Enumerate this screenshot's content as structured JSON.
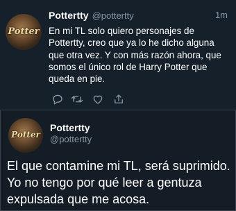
{
  "tweet": {
    "display_name": "Pottertty",
    "handle": "@pottertty",
    "time": "1m",
    "text": "En mi TL solo quiero personajes de Pottertty, creo que ya lo he dicho alguna que otra vez. Y con más razón ahora, que somos el único rol de Harry Potter que queda en pie.",
    "avatar_logo": "Potter",
    "actions": [
      "reply-icon",
      "retweet-icon",
      "like-icon",
      "share-icon"
    ]
  },
  "detail": {
    "display_name": "Pottertty",
    "handle": "@pottertty",
    "avatar_logo": "Potter",
    "text": "El que contamine mi TL, será suprimido. Yo no tengo por qué leer a gentuza expulsada que me acosa."
  },
  "colors": {
    "background": "#15202b",
    "secondary_text": "#8899a6",
    "divider": "#38444d"
  }
}
